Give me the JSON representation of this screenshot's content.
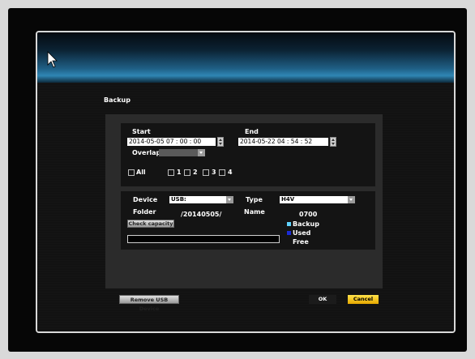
{
  "dialog": {
    "title": "Backup"
  },
  "time_range": {
    "start_label": "Start",
    "end_label": "End",
    "start_value": "2014-05-05 07 : 00 : 00",
    "end_value": "2014-05-22 04 : 54 : 52",
    "overlap_label": "Overlap"
  },
  "channels": {
    "all_label": "All",
    "items": [
      "1",
      "2",
      "3",
      "4"
    ]
  },
  "device": {
    "device_label": "Device",
    "device_value": "USB:",
    "type_label": "Type",
    "type_value": "H4V",
    "folder_label": "Folder",
    "folder_value": "/20140505/",
    "name_label": "Name",
    "name_value": "0700",
    "check_capacity_label": "Check capacity"
  },
  "legend": {
    "backup_label": "Backup",
    "used_label": "Used",
    "free_label": "Free",
    "backup_color": "#5fd3ff",
    "used_color": "#1a2bd6"
  },
  "buttons": {
    "remove_usb_label": "Remove USB Device",
    "ok_label": "OK",
    "cancel_label": "Cancel"
  }
}
